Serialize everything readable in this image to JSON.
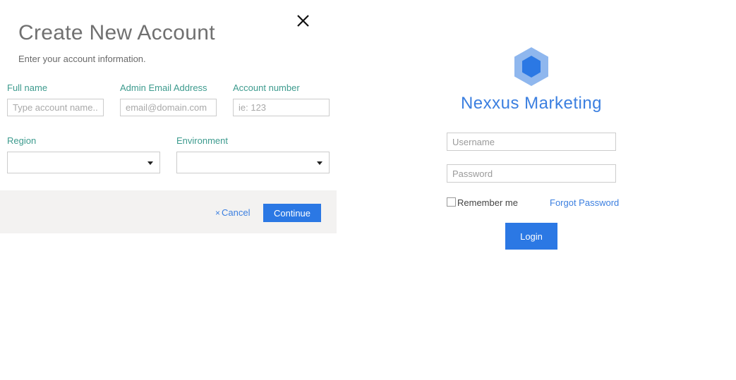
{
  "dialog": {
    "title": "Create New Account",
    "subtitle": "Enter your account information.",
    "close_icon": "close-icon",
    "fields": {
      "full_name": {
        "label": "Full name",
        "placeholder": "Type account name...",
        "value": ""
      },
      "admin_email": {
        "label": "Admin Email Address",
        "placeholder": "email@domain.com",
        "value": ""
      },
      "account_number": {
        "label": "Account number",
        "placeholder": "ie: 123",
        "value": ""
      },
      "region": {
        "label": "Region",
        "selected": ""
      },
      "environment": {
        "label": "Environment",
        "selected": ""
      }
    },
    "footer": {
      "cancel_label": "Cancel",
      "cancel_icon": "×",
      "continue_label": "Continue"
    }
  },
  "login": {
    "brand_name": "Nexxus Marketing",
    "logo_icon": "hexagon-logo-icon",
    "username_placeholder": "Username",
    "password_placeholder": "Password",
    "remember_label": "Remember me",
    "remember_checked": false,
    "forgot_label": "Forgot Password",
    "login_label": "Login"
  },
  "colors": {
    "accent": "#2b78e4",
    "link": "#3b7fe0",
    "label": "#3d9b8e",
    "footer_bg": "#f3f2f1",
    "logo_outer": "#8fb7ee",
    "logo_inner": "#2b78e4"
  }
}
